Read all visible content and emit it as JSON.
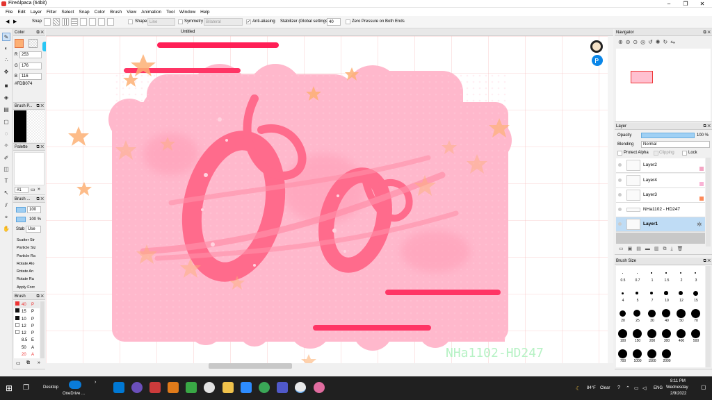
{
  "window": {
    "title": "FireAlpaca (64bit)",
    "minimize": "–",
    "restore": "❐",
    "close": "✕"
  },
  "menu": [
    "File",
    "Edit",
    "Layer",
    "Filter",
    "Select",
    "Snap",
    "Color",
    "Brush",
    "View",
    "Animation",
    "Tool",
    "Window",
    "Help"
  ],
  "toolbar": {
    "snap_label": "Snap",
    "shape_label": "Shape",
    "shape_value": "Line",
    "symmetry_label": "Symmetry",
    "symmetry_value": "Bilateral",
    "antialias_label": "Anti-aliasing",
    "stabilizer_label": "Stabilizer (Global settings)",
    "stabilizer_value": "40",
    "zero_pressure_label": "Zero Pressure on Both Ends"
  },
  "color_panel": {
    "title": "Color",
    "r_label": "R",
    "r": "253",
    "g_label": "G",
    "g": "176",
    "b_label": "B",
    "b": "116",
    "hex": "#FDB074",
    "color": "#fdb074"
  },
  "brush_preview_panel": {
    "title": "Brush P..."
  },
  "palette_panel": {
    "title": "Palette",
    "number": "#1"
  },
  "brush_settings_panel": {
    "title": "Brush ...",
    "size_value": "100",
    "opacity_value": "100 %",
    "stab_label": "Stab",
    "stab_value": "Use",
    "items": [
      "Scatter Str",
      "Particle Siz",
      "Particle Ra",
      "Rotate Alo",
      "Rotate An",
      "Rotate Ra",
      "Apply Forc"
    ]
  },
  "brush_list_panel": {
    "title": "Brush",
    "items": [
      {
        "size": "40",
        "name": "P"
      },
      {
        "size": "15",
        "name": "P"
      },
      {
        "size": "10",
        "name": "P"
      },
      {
        "size": "12",
        "name": "P"
      },
      {
        "size": "12",
        "name": "P"
      },
      {
        "size": "8.5",
        "name": "E"
      },
      {
        "size": "50",
        "name": "A"
      },
      {
        "size": "20",
        "name": "A"
      }
    ]
  },
  "document": {
    "tab_title": "Untitled",
    "watermark": "NHa1102-HD247"
  },
  "navigator": {
    "title": "Navigator"
  },
  "layer_panel": {
    "title": "Layer",
    "opacity_label": "Opacity",
    "opacity_value": "100 %",
    "blending_label": "Blending",
    "blending_value": "Normal",
    "protect_alpha": "Protect Alpha",
    "clipping": "Clipping",
    "lock": "Lock",
    "layers": [
      {
        "name": "Layer2",
        "tag_color": "#f4a6c4"
      },
      {
        "name": "Layer4",
        "tag_color": "#f9b3d5"
      },
      {
        "name": "Layer3",
        "tag_color": "#fd8a5a"
      },
      {
        "name": "NHa1102 - HD247",
        "tag_color": ""
      },
      {
        "name": "Layer1",
        "tag_color": ""
      }
    ]
  },
  "brush_size_panel": {
    "title": "Brush Size",
    "sizes": [
      "0.5",
      "0.7",
      "1",
      "1.5",
      "2",
      "3",
      "4",
      "5",
      "7",
      "10",
      "12",
      "15",
      "20",
      "25",
      "30",
      "40",
      "50",
      "70",
      "100",
      "150",
      "200",
      "300",
      "400",
      "500",
      "700",
      "1000",
      "1500",
      "2000"
    ]
  },
  "taskbar": {
    "desktop_label": "Desktop",
    "onedrive_label": "OneDrive ...",
    "weather_temp": "84°F",
    "weather_text": "Clear",
    "lang": "ENG",
    "time": "8:11 PM",
    "day": "Wednesday",
    "date": "2/9/2022"
  },
  "colors": {
    "accent": "#3b8ad8",
    "art_pink": "#ffb6c9",
    "art_red": "#ff3d6b",
    "star": "#fdb074"
  }
}
